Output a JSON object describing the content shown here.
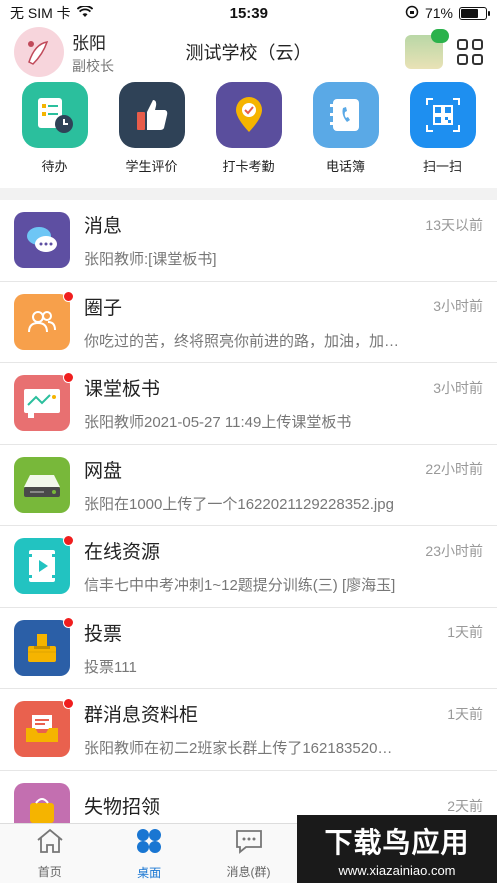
{
  "status_bar": {
    "carrier": "无 SIM 卡",
    "time": "15:39",
    "battery": "71%",
    "battery_level": 0.71
  },
  "header": {
    "user_name": "张阳",
    "user_role": "副校长",
    "school_name": "测试学校（云）"
  },
  "shortcuts": [
    {
      "label": "待办",
      "icon": "todo-icon",
      "color": "#2bbf9d"
    },
    {
      "label": "学生评价",
      "icon": "thumbs-up-icon",
      "color": "#2f4257"
    },
    {
      "label": "打卡考勤",
      "icon": "location-pin-icon",
      "color": "#5a4e9d"
    },
    {
      "label": "电话簿",
      "icon": "phone-book-icon",
      "color": "#5aa9e6"
    },
    {
      "label": "扫一扫",
      "icon": "qr-scan-icon",
      "color": "#1e8ff0"
    }
  ],
  "messages": [
    {
      "title": "消息",
      "subtitle": "张阳教师:[课堂板书]",
      "time": "13天以前",
      "icon": "chat-bubble-icon",
      "color": "#5e4fa2",
      "badge": false
    },
    {
      "title": "圈子",
      "subtitle": "你吃过的苦，终将照亮你前进的路，加油，加…",
      "time": "3小时前",
      "icon": "group-icon",
      "color": "#f7a04b",
      "badge": true
    },
    {
      "title": "课堂板书",
      "subtitle": "张阳教师2021-05-27 11:49上传课堂板书",
      "time": "3小时前",
      "icon": "blackboard-icon",
      "color": "#e87071",
      "badge": true
    },
    {
      "title": "网盘",
      "subtitle": "张阳在1000上传了一个1622021129228352.jpg",
      "time": "22小时前",
      "icon": "hard-drive-icon",
      "color": "#78b83a",
      "badge": false
    },
    {
      "title": "在线资源",
      "subtitle": "信丰七中中考冲刺1~12题提分训练(三) [廖海玉]",
      "time": "23小时前",
      "icon": "video-icon",
      "color": "#22c3c1",
      "badge": true
    },
    {
      "title": "投票",
      "subtitle": "投票111",
      "time": "1天前",
      "icon": "ballot-box-icon",
      "color": "#2b5fa7",
      "badge": true
    },
    {
      "title": "群消息资料柜",
      "subtitle": "张阳教师在初二2班家长群上传了162183520…",
      "time": "1天前",
      "icon": "inbox-icon",
      "color": "#e9614e",
      "badge": true
    },
    {
      "title": "失物招领",
      "subtitle": "",
      "time": "2天前",
      "icon": "lost-found-icon",
      "color": "#c36fb0",
      "badge": false
    }
  ],
  "tabbar": [
    {
      "label": "首页",
      "icon": "home-icon",
      "active": false
    },
    {
      "label": "桌面",
      "icon": "desktop-grid-icon",
      "active": true
    },
    {
      "label": "消息(群)",
      "icon": "message-icon",
      "active": false
    }
  ],
  "watermark": {
    "title": "下载鸟应用",
    "url": "www.xiazainiao.com"
  },
  "colors": {
    "accent": "#1976d2",
    "badge": "#f01e1e"
  }
}
